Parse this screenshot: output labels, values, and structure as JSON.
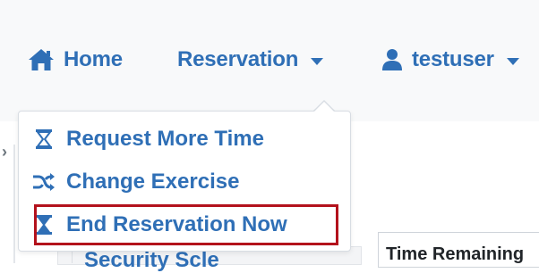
{
  "navbar": {
    "home_label": "Home",
    "reservation_label": "Reservation",
    "user_label": "testuser",
    "icons": {
      "home": "home-icon",
      "user": "user-icon",
      "caret": "caret-down-icon"
    }
  },
  "dropdown": {
    "items": [
      {
        "label": "Request More Time",
        "icon": "hourglass-icon"
      },
      {
        "label": "Change Exercise",
        "icon": "shuffle-icon"
      },
      {
        "label": "End Reservation Now",
        "icon": "hourglass-icon",
        "highlighted": true
      }
    ]
  },
  "content": {
    "time_remaining_label": "Time Remaining",
    "bottom_partial_text": "Security Scle"
  },
  "colors": {
    "accent": "#2f6fb6",
    "highlight_border": "#b3121c",
    "navbar_bg": "#f8f9fa"
  }
}
